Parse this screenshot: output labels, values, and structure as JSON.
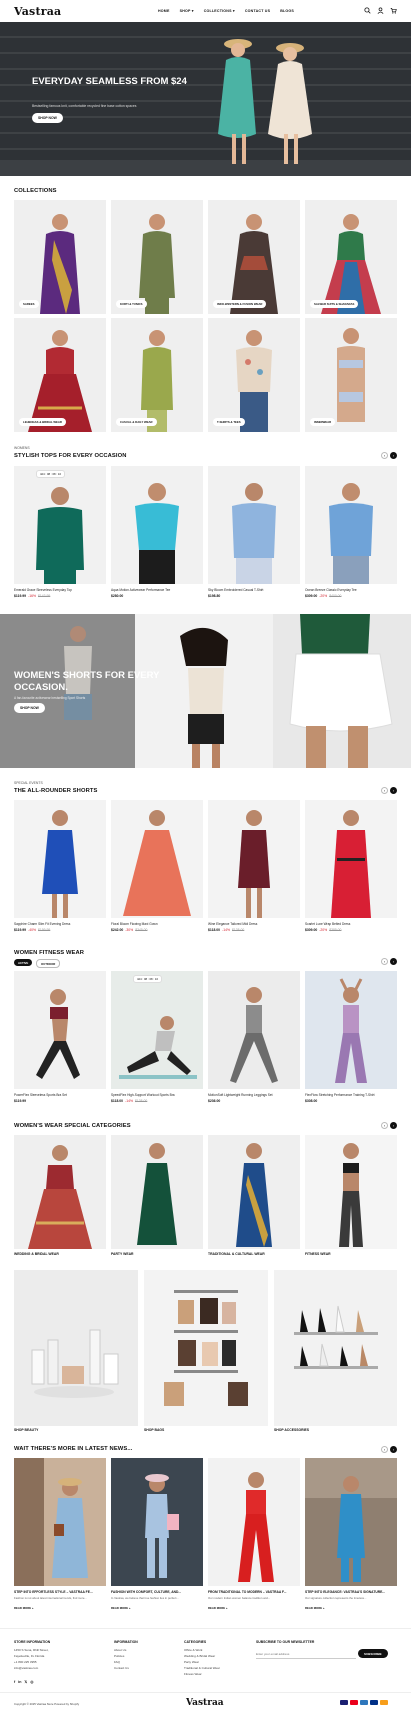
{
  "header": {
    "logo": "Vastraa",
    "nav": [
      "HOME",
      "SHOP ▾",
      "COLLECTIONS ▾",
      "CONTACT US",
      "BLOGS"
    ]
  },
  "hero": {
    "title": "EVERYDAY SEAMLESS FROM $24",
    "subtitle": "Bestselling famous knit, comfortable recycled fine base cotton spaces",
    "button": "SHOP NOW"
  },
  "collections": {
    "heading": "COLLECTIONS",
    "items": [
      "SAREES",
      "KURTI & TUNICS",
      "INDO-WESTERN & FUSION WEAR",
      "SALWAR SUITS & SHARARAS",
      "LEHENGAS & BRIDAL WEAR",
      "CASUAL & DAILY WEAR",
      "T-SHIRTS & TEES",
      "INNERWEAR"
    ]
  },
  "tops": {
    "eyebrow": "WOMENS",
    "heading": "STYLISH TOPS FOR EVERY OCCASION",
    "countdown": "424 : 08 : 08 : 10",
    "products": [
      {
        "name": "Emerald Grace Sleeveless Everyday Top",
        "price": "$119.99",
        "off": "-16%",
        "was": "$143.99"
      },
      {
        "name": "Aqua Motion Activewear Performance Tee",
        "price": "$280.00",
        "off": "",
        "was": ""
      },
      {
        "name": "Sky Bloom Embroidered Casual T-Shirt",
        "price": "$198.80",
        "off": "",
        "was": ""
      },
      {
        "name": "Ocean Breeze Classic Everyday Tee",
        "price": "$309.00",
        "off": "-20%",
        "was": "$400.00"
      }
    ]
  },
  "shorts_banner": {
    "title": "WOMEN'S SHORTS FOR EVERY OCCASION.",
    "subtitle": "A fan-favourite activewear bestselling Sport Shorts",
    "button": "SHOP NOW"
  },
  "allrounder": {
    "eyebrow": "SPECIAL EVENTS",
    "heading": "THE ALL-ROUNDER SHORTS",
    "products": [
      {
        "name": "Sapphire Charm Slim Fit Evening Dress",
        "price": "$119.99",
        "off": "-40%",
        "was": "$199.99"
      },
      {
        "name": "Floral Bloom Flowing Maxi Gown",
        "price": "$242.00",
        "off": "-30%",
        "was": "$345.00"
      },
      {
        "name": "Wine Elegance Tailored Midi Dress",
        "price": "$118.00",
        "off": "-14%",
        "was": "$138.00"
      },
      {
        "name": "Scarlet Luxe Wrap Belted Dress",
        "price": "$309.00",
        "off": "-20%",
        "was": "$385.00"
      }
    ]
  },
  "fitness": {
    "heading": "WOMEN FITNESS WEAR",
    "tabs": [
      "ACTIVE",
      "OUTDOOR"
    ],
    "countdown": "424 : 08 : 08 : 10",
    "products": [
      {
        "name": "PowerFlex Sleeveless Sports Bra Set",
        "price": "$119.99",
        "off": "",
        "was": ""
      },
      {
        "name": "SpeedFlex High-Support Workout Sports Bra",
        "price": "$118.00",
        "off": "-14%",
        "was": "$138.00"
      },
      {
        "name": "MotionSoft Lightweight Running Leggings Set",
        "price": "$236.00",
        "off": "",
        "was": ""
      },
      {
        "name": "FlexFlow Stretching Performance Training T-Shirt",
        "price": "$308.00",
        "off": "",
        "was": ""
      }
    ]
  },
  "special": {
    "heading": "WOMEN'S WEAR SPECIAL CATEGORIES",
    "cats": [
      "WEDDING & BRIDAL WEAR",
      "PARTY WEAR",
      "TRADITIONAL & CULTURAL WEAR",
      "FITNESS WEAR"
    ],
    "wide": [
      "SHOP BEAUTY",
      "SHOP BAGS",
      "SHOP ACCESSORIES"
    ]
  },
  "news": {
    "heading": "WAIT THERE'S MORE IN LATEST NEWS...",
    "posts": [
      {
        "title": "STEP INTO EFFORTLESS STYLE – VASTRAA FE...",
        "excerpt": "Fashion is not about latest international trends, find more..."
      },
      {
        "title": "FASHION WITH COMFORT, CULTURE, AND...",
        "excerpt": "In Vastraa, we believe that true fashion lies in perfect..."
      },
      {
        "title": "FROM TRADITIONAL TO MODERN – VASTRAA F...",
        "excerpt": "Our modern Indian women balance tradition and..."
      },
      {
        "title": "STEP INTO ELEGANCE: VASTRAA'S SIGNATURE...",
        "excerpt": "Our signature collection represents the timeless..."
      }
    ],
    "read_more": "READ MORE »"
  },
  "footer": {
    "store_title": "STORE INFORMATION",
    "store_lines": [
      "1450 S Suna, Rhill Street,",
      "Fayetteville, FL Florida",
      "+1 800 225 3955",
      "info@vastraa.com"
    ],
    "info_title": "INFORMATION",
    "info_lines": [
      "About Us",
      "Policies",
      "FAQ",
      "Contact Us"
    ],
    "cat_title": "CATEGORIES",
    "cat_lines": [
      "Office & Work",
      "Wedding & Bridal Wear",
      "Party Wear",
      "Traditional & Cultural Wear",
      "Fitness Wear"
    ],
    "news_title": "SUBSCRIBE TO OUR NEWSLETTER",
    "news_placeholder": "Enter your email address",
    "subscribe": "SUBSCRIBE",
    "copyright": "Copyright © 2025 Vastraa Store Powered by Shopify",
    "logo": "Vastraa"
  },
  "colors": {
    "accent": "#111111",
    "sale": "#d21f2b",
    "hero_bg": "#2e3236"
  },
  "icons": [
    "search-icon",
    "user-icon",
    "cart-icon",
    "chevron-left-icon",
    "chevron-right-icon"
  ]
}
